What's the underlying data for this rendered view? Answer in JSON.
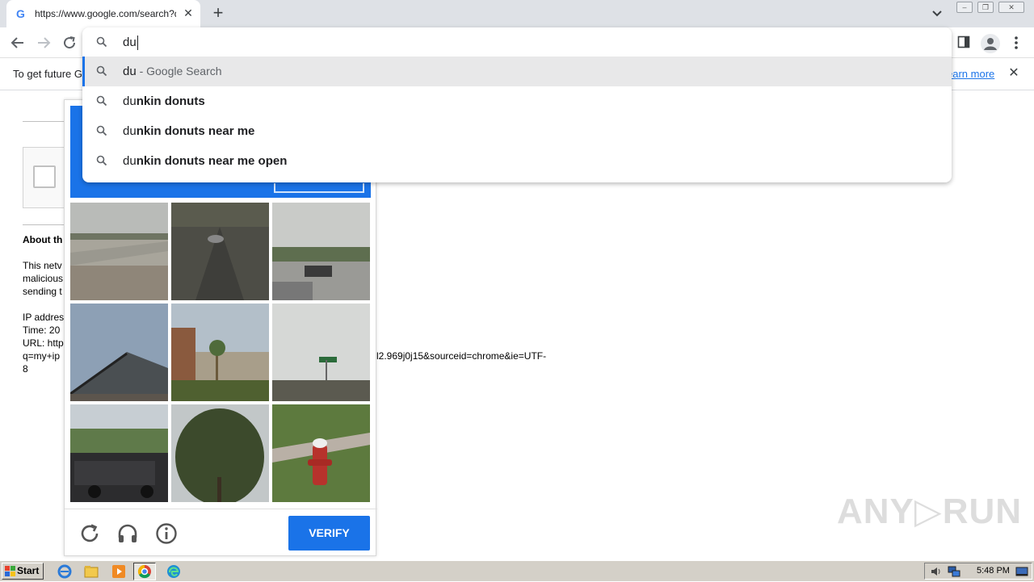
{
  "browser": {
    "tab": {
      "title": "https://www.google.com/search?q=",
      "favicon": "G",
      "close": "✕"
    },
    "new_tab": "+",
    "window_controls": {
      "minimize": "–",
      "restore": "❐",
      "close": "✕"
    }
  },
  "omnibox": {
    "typed": "du",
    "suggestions": [
      {
        "match": "du",
        "rest": "",
        "hint": " - Google Search",
        "selected": true
      },
      {
        "match": "du",
        "rest": "nkin donuts",
        "hint": "",
        "selected": false
      },
      {
        "match": "du",
        "rest": "nkin donuts near me",
        "hint": "",
        "selected": false
      },
      {
        "match": "du",
        "rest": "nkin donuts near me open",
        "hint": "",
        "selected": false
      }
    ]
  },
  "infobar": {
    "message": "To get future G",
    "learn_more": "earn more",
    "close": "✕"
  },
  "page": {
    "about_heading": "About th",
    "para_lines": [
      "This netv",
      "malicious",
      "sending t"
    ],
    "ip_line": "IP addres",
    "time_line": "Time: 20",
    "url_line": "URL: http",
    "url_cont1": "q=my+ip",
    "url_cont2": "8",
    "url_tail": "l2.969j0j15&sourceid=chrome&ie=UTF-"
  },
  "captcha": {
    "verify_label": "VERIFY",
    "icons": [
      "reload-icon",
      "headphones-icon",
      "info-icon"
    ]
  },
  "watermark": "ANY▷RUN",
  "taskbar": {
    "start_label": "Start",
    "time": "5:48 PM"
  }
}
